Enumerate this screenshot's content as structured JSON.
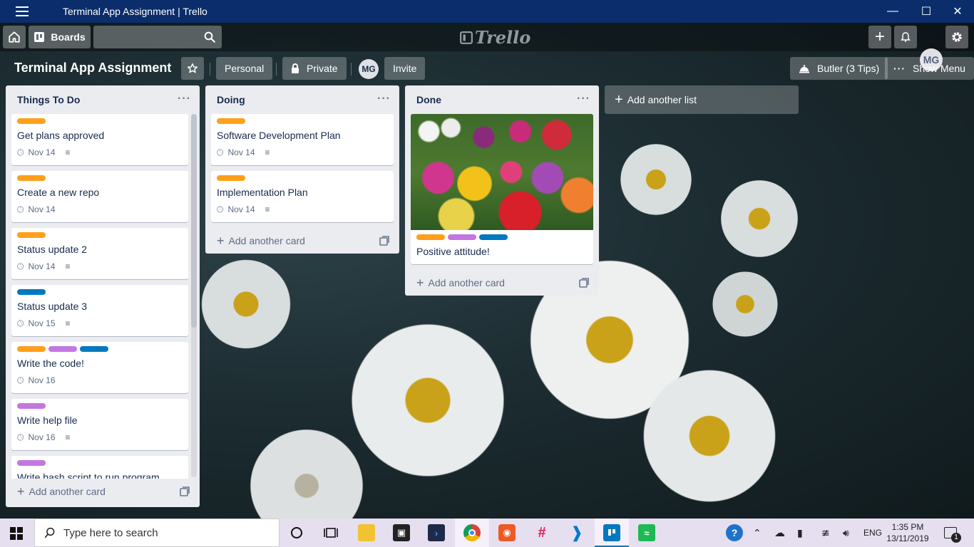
{
  "window": {
    "title": "Terminal App Assignment | Trello",
    "controls": [
      "minimize",
      "maximize",
      "close"
    ]
  },
  "header": {
    "boards_label": "Boards",
    "search_placeholder": "",
    "logo_text": "Trello",
    "avatar_initials": "MG"
  },
  "board": {
    "title": "Terminal App Assignment",
    "team_label": "Personal",
    "visibility_label": "Private",
    "member_initials": "MG",
    "invite_label": "Invite",
    "butler_label": "Butler (3 Tips)",
    "show_menu_label": "Show Menu"
  },
  "colors": {
    "orange": "#ff9f1a",
    "purple": "#c377e0",
    "blue": "#0079bf"
  },
  "lists": [
    {
      "name": "Things To Do",
      "add_card_label": "Add another card",
      "cards": [
        {
          "title": "Get plans approved",
          "labels": [
            "orange"
          ],
          "due": "Nov 14",
          "has_description": true
        },
        {
          "title": "Create a new repo",
          "labels": [
            "orange"
          ],
          "due": "Nov 14",
          "has_description": false
        },
        {
          "title": "Status update 2",
          "labels": [
            "orange"
          ],
          "due": "Nov 14",
          "has_description": true
        },
        {
          "title": "Status update 3",
          "labels": [
            "blue"
          ],
          "due": "Nov 15",
          "has_description": true
        },
        {
          "title": "Write the code!",
          "labels": [
            "orange",
            "purple",
            "blue"
          ],
          "due": "Nov 16",
          "has_description": false
        },
        {
          "title": "Write help file",
          "labels": [
            "purple"
          ],
          "due": "Nov 16",
          "has_description": true
        },
        {
          "title": "Write bash script to run program",
          "labels": [
            "purple"
          ],
          "due": "",
          "has_description": false
        }
      ]
    },
    {
      "name": "Doing",
      "add_card_label": "Add another card",
      "cards": [
        {
          "title": "Software Development Plan",
          "labels": [
            "orange"
          ],
          "due": "Nov 14",
          "has_description": true
        },
        {
          "title": "Implementation Plan",
          "labels": [
            "orange"
          ],
          "due": "Nov 14",
          "has_description": true
        }
      ]
    },
    {
      "name": "Done",
      "add_card_label": "Add another card",
      "cards": [
        {
          "title": "Positive attitude!",
          "labels": [
            "orange",
            "purple",
            "blue"
          ],
          "due": "",
          "has_description": false,
          "cover": "tulips-photo"
        }
      ]
    }
  ],
  "add_list_label": "Add another list",
  "taskbar": {
    "search_placeholder": "Type here to search",
    "language": "ENG",
    "time": "1:35 PM",
    "date": "13/11/2019",
    "notification_count": "1"
  }
}
